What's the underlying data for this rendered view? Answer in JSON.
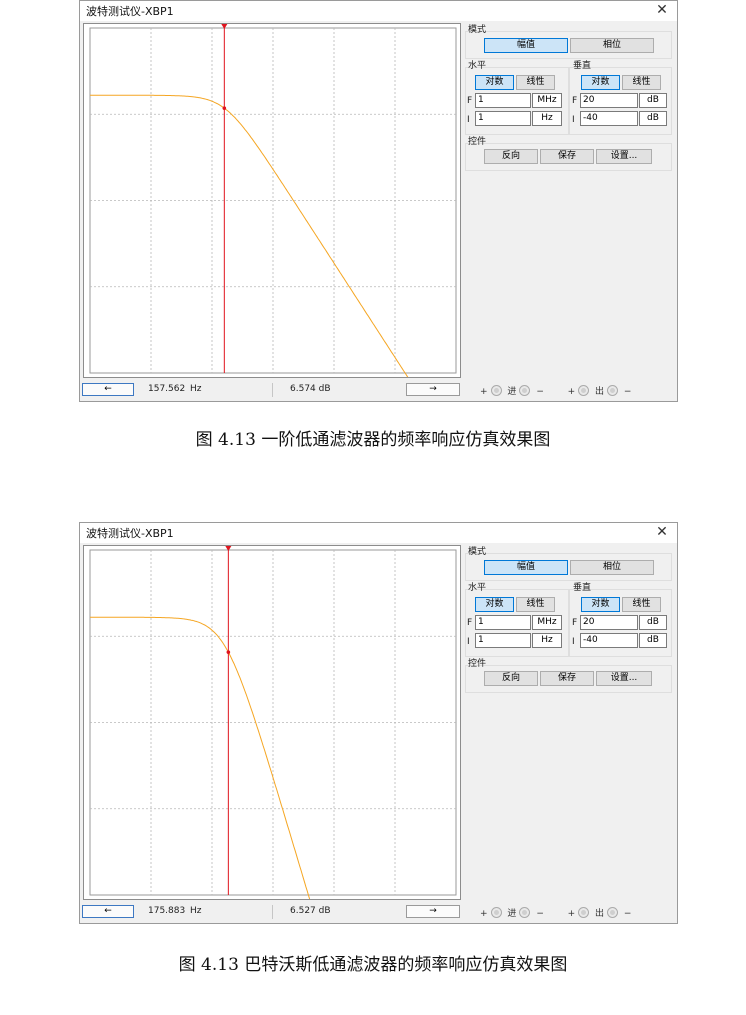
{
  "windows": [
    {
      "title": "波特测试仪-XBP1",
      "close_glyph": "✕",
      "mode": {
        "label": "模式",
        "magnitude": "幅值",
        "phase": "相位",
        "active": "magnitude"
      },
      "horizontal": {
        "label": "水平",
        "log": "对数",
        "linear": "线性",
        "active": "log",
        "final_label": "F",
        "final_value": "1",
        "final_unit": "MHz",
        "initial_label": "I",
        "initial_value": "1",
        "initial_unit": "Hz"
      },
      "vertical": {
        "label": "垂直",
        "log": "对数",
        "linear": "线性",
        "active": "log",
        "final_label": "F",
        "final_value": "20",
        "final_unit": "dB",
        "initial_label": "I",
        "initial_value": "-40",
        "initial_unit": "dB"
      },
      "controls": {
        "label": "控件",
        "reverse": "反向",
        "save": "保存",
        "settings": "设置..."
      },
      "status": {
        "left_arrow": "←",
        "right_arrow": "→",
        "freq": "157.562",
        "freq_unit": "Hz",
        "gain": "6.574 dB"
      },
      "terminals": {
        "plus": "+",
        "minus": "−",
        "in": "进",
        "out": "出"
      },
      "plot": {
        "trace_color": "#f5a623",
        "cursor_color": "#e0141e",
        "grid_color": "#b8b8b8",
        "passband_level": 0.195,
        "knee_x": 0.37,
        "cursor_x": 0.367,
        "slope": 1.64
      }
    },
    {
      "title": "波特测试仪-XBP1",
      "close_glyph": "✕",
      "mode": {
        "label": "模式",
        "magnitude": "幅值",
        "phase": "相位",
        "active": "magnitude"
      },
      "horizontal": {
        "label": "水平",
        "log": "对数",
        "linear": "线性",
        "active": "log",
        "final_label": "F",
        "final_value": "1",
        "final_unit": "MHz",
        "initial_label": "I",
        "initial_value": "1",
        "initial_unit": "Hz"
      },
      "vertical": {
        "label": "垂直",
        "log": "对数",
        "linear": "线性",
        "active": "log",
        "final_label": "F",
        "final_value": "20",
        "final_unit": "dB",
        "initial_label": "I",
        "initial_value": "-40",
        "initial_unit": "dB"
      },
      "controls": {
        "label": "控件",
        "reverse": "反向",
        "save": "保存",
        "settings": "设置..."
      },
      "status": {
        "left_arrow": "←",
        "right_arrow": "→",
        "freq": "175.883",
        "freq_unit": "Hz",
        "gain": "6.527 dB"
      },
      "terminals": {
        "plus": "+",
        "minus": "−",
        "in": "进",
        "out": "出"
      },
      "plot": {
        "trace_color": "#f5a623",
        "cursor_color": "#e0141e",
        "grid_color": "#b8b8b8",
        "passband_level": 0.195,
        "knee_x": 0.37,
        "cursor_x": 0.378,
        "slope": 3.55
      }
    }
  ],
  "captions": [
    "图 4.13 一阶低通滤波器的频率响应仿真效果图",
    "图 4.13 巴特沃斯低通滤波器的频率响应仿真效果图"
  ]
}
